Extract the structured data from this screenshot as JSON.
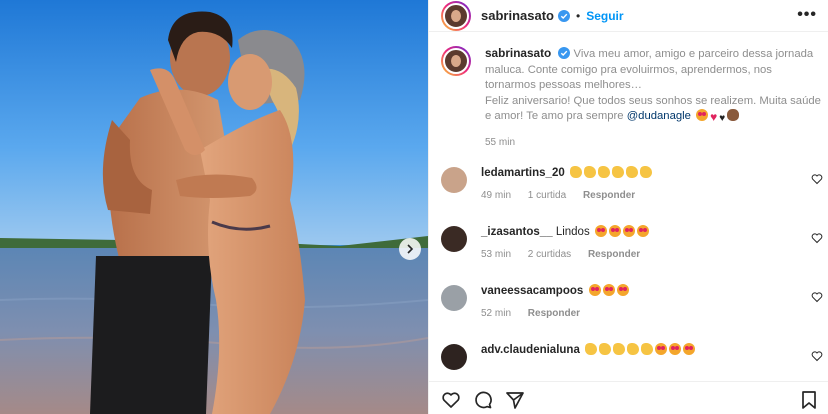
{
  "post": {
    "username": "sabrinasato",
    "follow_label": "Seguir",
    "dot": "•",
    "more_label": "•••"
  },
  "caption": {
    "username": "sabrinasato",
    "text_part1": "Viva meu amor, amigo e parceiro dessa jornada maluca. Conte comigo pra evoluirmos, aprendermos, nos tornarmos pessoas melhores…",
    "text_part2": "Feliz aniversario! Que todos seus sonhos se realizem. Muita saúde e amor! Te amo pra sempre ",
    "mention": "@dudanagle",
    "time": "55 min"
  },
  "comments": [
    {
      "username": "ledamartins_20",
      "text": "",
      "emojis": [
        "clap",
        "clap",
        "clap",
        "clap",
        "clap",
        "clap"
      ],
      "time": "49 min",
      "likes": "1 curtida",
      "reply": "Responder"
    },
    {
      "username": "_izasantos__",
      "text": "Lindos",
      "emojis": [
        "love",
        "love",
        "love",
        "love"
      ],
      "time": "53 min",
      "likes": "2 curtidas",
      "reply": "Responder"
    },
    {
      "username": "vaneessacampoos",
      "text": "",
      "emojis": [
        "love",
        "love",
        "love"
      ],
      "time": "52 min",
      "likes": "",
      "reply": "Responder"
    },
    {
      "username": "adv.claudenialuna",
      "text": "",
      "emojis": [
        "clap",
        "clap",
        "clap",
        "clap",
        "clap",
        "love",
        "love",
        "love"
      ],
      "time": "",
      "likes": "",
      "reply": ""
    }
  ],
  "icons": {
    "verified": "verified-badge-icon",
    "like": "heart-icon",
    "comment": "comment-icon",
    "share": "paper-plane-icon",
    "save": "bookmark-icon",
    "next": "chevron-right-icon"
  },
  "colors": {
    "follow": "#0095f6",
    "mention": "#00376b",
    "secondary_text": "#8e8e8e",
    "sky": "#2e86dd"
  }
}
